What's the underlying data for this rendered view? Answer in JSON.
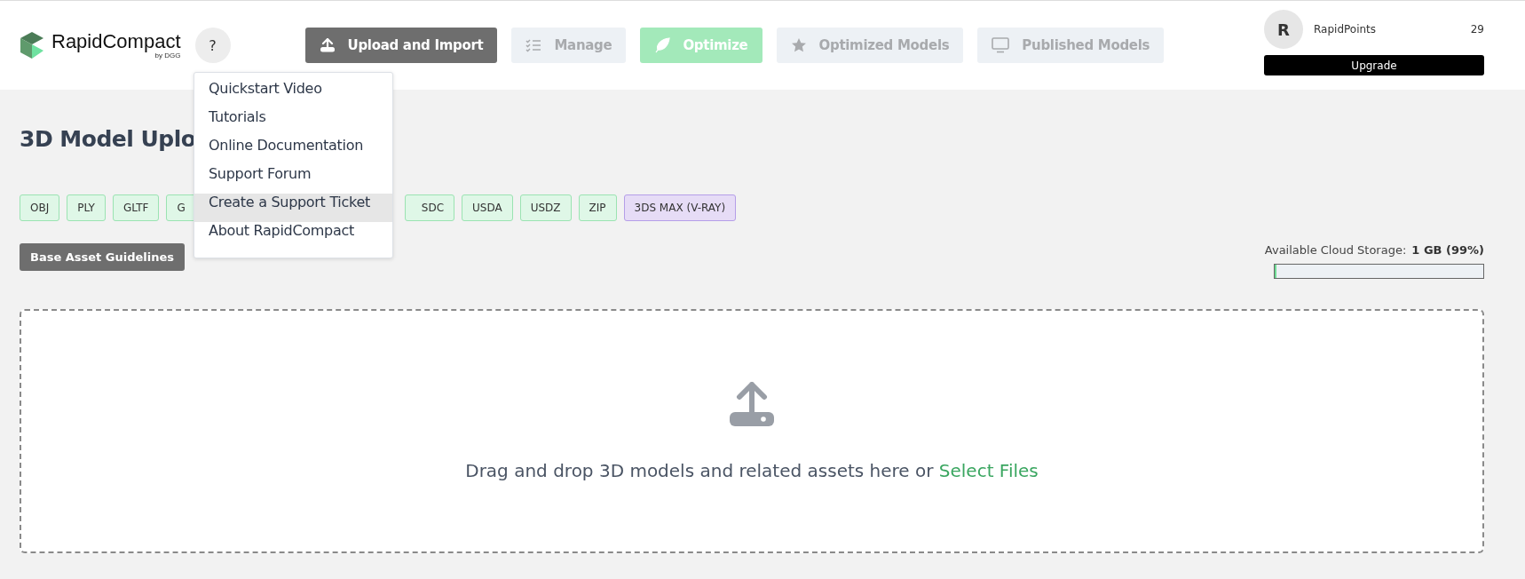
{
  "header": {
    "logo": {
      "name": "RapidCompact",
      "byline": "by DGG"
    },
    "help_button": {
      "label": "?"
    },
    "nav": [
      {
        "label": "Upload and Import",
        "kind": "active"
      },
      {
        "label": "Manage",
        "kind": "disabled"
      },
      {
        "label": "Optimize",
        "kind": "accent"
      },
      {
        "label": "Optimized Models",
        "kind": "disabled"
      },
      {
        "label": "Published Models",
        "kind": "disabled"
      }
    ],
    "account": {
      "avatar": "R",
      "points_label": "RapidPoints",
      "points": "29",
      "upgrade": "Upgrade"
    }
  },
  "help_menu": {
    "items": [
      {
        "label": "Quickstart Video",
        "selected": false
      },
      {
        "label": "Tutorials",
        "selected": false
      },
      {
        "label": "Online Documentation",
        "selected": false
      },
      {
        "label": "Support Forum",
        "selected": false
      },
      {
        "label": "Create a Support Ticket",
        "selected": true
      },
      {
        "label": "About RapidCompact",
        "selected": false
      }
    ]
  },
  "page": {
    "title": "3D Model Uplo",
    "formats": [
      {
        "label": "OBJ",
        "kind": "format"
      },
      {
        "label": "PLY",
        "kind": "format"
      },
      {
        "label": "GLTF",
        "kind": "format"
      },
      {
        "label": "G",
        "kind": "cut_right"
      },
      {
        "label": "SDC",
        "kind": "cut_left"
      },
      {
        "label": "USDA",
        "kind": "format"
      },
      {
        "label": "USDZ",
        "kind": "format"
      },
      {
        "label": "ZIP",
        "kind": "format"
      },
      {
        "label": "3DS MAX (V-RAY)",
        "kind": "special"
      }
    ],
    "guidelines_button": "Base Asset Guidelines",
    "storage": {
      "label": "Available Cloud Storage:",
      "value": "1 GB (99%)",
      "level": 0.01
    },
    "dropzone": {
      "text": "Drag and drop 3D models and related assets here or",
      "link": "Select Files"
    }
  }
}
